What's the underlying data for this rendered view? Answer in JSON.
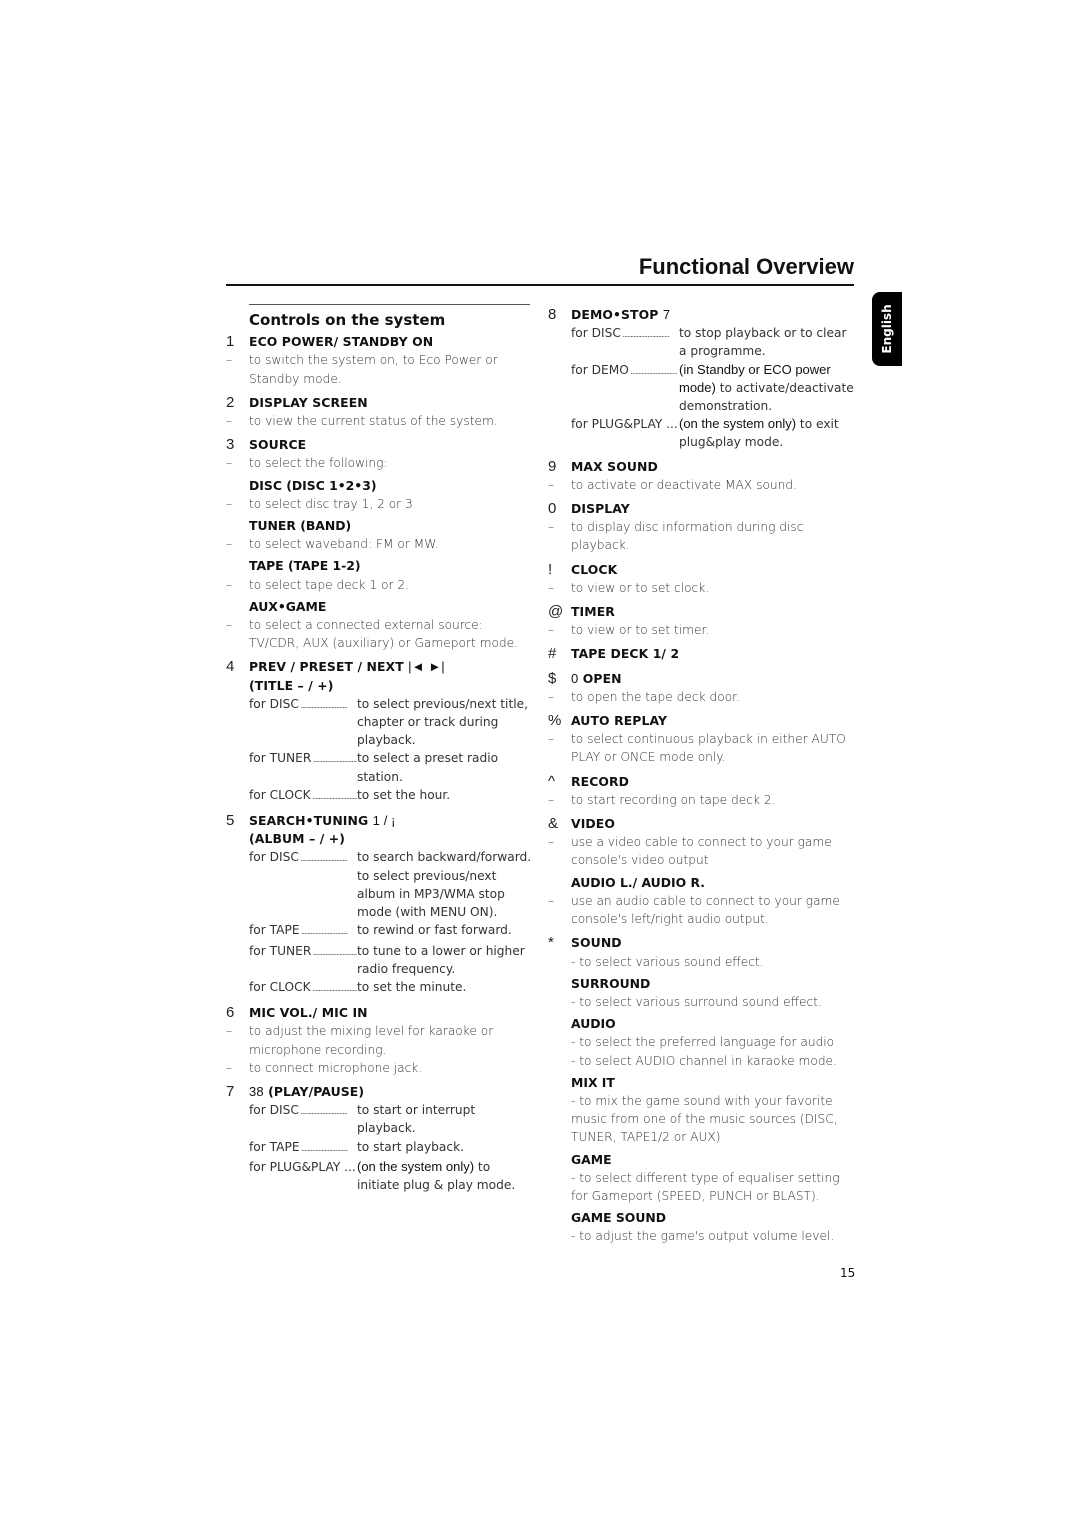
{
  "header": {
    "title": "Functional Overview",
    "language_tab": "English"
  },
  "section": {
    "title": "Controls on the system"
  },
  "left_items": [
    {
      "num": "1",
      "head": "ECO POWER/ STANDBY ON",
      "lines": [
        "to switch the system on, to Eco Power or Standby mode."
      ]
    },
    {
      "num": "2",
      "head": "DISPLAY SCREEN",
      "lines": [
        "to view the current status of the system."
      ]
    },
    {
      "num": "3",
      "head": "SOURCE",
      "lines": [
        "to select the following:"
      ],
      "subs": [
        {
          "head": "DISC (DISC 1•2•3)",
          "line": "to select disc tray 1, 2 or 3"
        },
        {
          "head": "TUNER (BAND)",
          "line": "to select waveband: FM or MW."
        },
        {
          "head": "TAPE (TAPE 1-2)",
          "line": "to select tape deck 1 or 2."
        },
        {
          "head": "AUX•GAME",
          "line": "to select a connected external source: TV/CDR, AUX (auxiliary) or Gameport mode."
        }
      ]
    },
    {
      "num": "4",
      "head": "PREV / PRESET / NEXT",
      "head_sym": "|◄ ►|",
      "head2": "(TITLE – / +)",
      "rows": [
        {
          "label": "for DISC",
          "desc": "to select previous/next title, chapter or track during playback."
        },
        {
          "label": "for TUNER",
          "desc": "to select a preset radio station."
        },
        {
          "label": "for CLOCK",
          "desc": "to set the hour."
        }
      ]
    },
    {
      "num": "5",
      "head": "SEARCH•TUNING",
      "head_sym": "1     / ¡",
      "head2": "(ALBUM – / +)",
      "rows": [
        {
          "label": "for DISC",
          "desc": "to search backward/forward. to select previous/next album in MP3/WMA stop mode (with MENU ON)."
        },
        {
          "label": "for TAPE",
          "desc": "to rewind or fast forward."
        },
        {
          "label": "for TUNER",
          "desc": "to tune to a lower or higher radio frequency."
        },
        {
          "label": "for CLOCK",
          "desc": "to set the minute."
        }
      ]
    },
    {
      "num": "6",
      "head": "MIC VOL./ MIC IN",
      "lines": [
        "to adjust the mixing level for karaoke or microphone recording.",
        "to connect microphone jack."
      ]
    },
    {
      "num": "7",
      "head_sym_pre": "38",
      "head": "(PLAY/PAUSE)",
      "rows": [
        {
          "label": "for DISC",
          "desc": "to start or interrupt playback."
        },
        {
          "label": "for TAPE",
          "desc": "to start playback."
        },
        {
          "label": "for PLUG&PLAY ...",
          "desc_alt": "(on the system only)",
          "desc": " to initiate plug & play mode."
        }
      ]
    }
  ],
  "right_items": [
    {
      "num": "8",
      "head": "DEMO•STOP",
      "head_sym": "7",
      "rows": [
        {
          "label": "for DISC",
          "desc": "to stop playback or to clear a programme."
        },
        {
          "label": "for DEMO",
          "desc_alt": "(in Standby or ECO power mode)",
          "desc": " to activate/deactivate demonstration."
        },
        {
          "label": "for PLUG&PLAY ...",
          "desc_alt": "(on the system only)",
          "desc": " to exit plug&play mode."
        }
      ]
    },
    {
      "num": "9",
      "head": "MAX SOUND",
      "lines": [
        "to activate or deactivate MAX sound."
      ]
    },
    {
      "num": "0",
      "head": "DISPLAY",
      "lines": [
        "to display disc information during disc playback."
      ]
    },
    {
      "num": "!",
      "head": "CLOCK",
      "lines": [
        "to view or to set clock."
      ]
    },
    {
      "num": "@",
      "head": "TIMER",
      "lines": [
        "to view or to set timer."
      ]
    },
    {
      "num": "#",
      "head": "TAPE DECK 1/ 2",
      "lines": []
    },
    {
      "num": "$",
      "head_sym_pre": "0",
      "head": "OPEN",
      "lines": [
        "to open the tape deck door."
      ]
    },
    {
      "num": "%",
      "head": "AUTO REPLAY",
      "lines": [
        "to select continuous playback in either AUTO PLAY or ONCE mode only."
      ]
    },
    {
      "num": "^",
      "head": "RECORD",
      "lines": [
        "to start recording on tape deck 2."
      ]
    },
    {
      "num": "&",
      "head": "VIDEO",
      "lines": [
        "use a video cable to connect to your game console's video output"
      ],
      "subs": [
        {
          "head": "AUDIO L./ AUDIO R.",
          "line": "use an audio cable to connect to your game console's left/right audio output."
        }
      ]
    },
    {
      "num": "*",
      "head": "SOUND",
      "plain": [
        "- to select various sound effect."
      ],
      "plain_subs": [
        {
          "head": "SURROUND",
          "lines": [
            "- to select various surround sound effect."
          ]
        },
        {
          "head": "AUDIO",
          "lines": [
            "- to select the preferred language for audio",
            "- to select AUDIO channel in karaoke mode."
          ]
        },
        {
          "head": "MIX IT",
          "lines": [
            "- to mix the game sound with your favorite music from one of the music sources (DISC, TUNER, TAPE1/2 or AUX)"
          ]
        },
        {
          "head": "GAME",
          "lines": [
            "- to select different type of equaliser setting for Gameport (SPEED, PUNCH or BLAST)."
          ]
        },
        {
          "head": "GAME SOUND",
          "lines": [
            "- to adjust the game's output volume level."
          ]
        }
      ]
    }
  ],
  "footer": {
    "page_number": "15"
  }
}
